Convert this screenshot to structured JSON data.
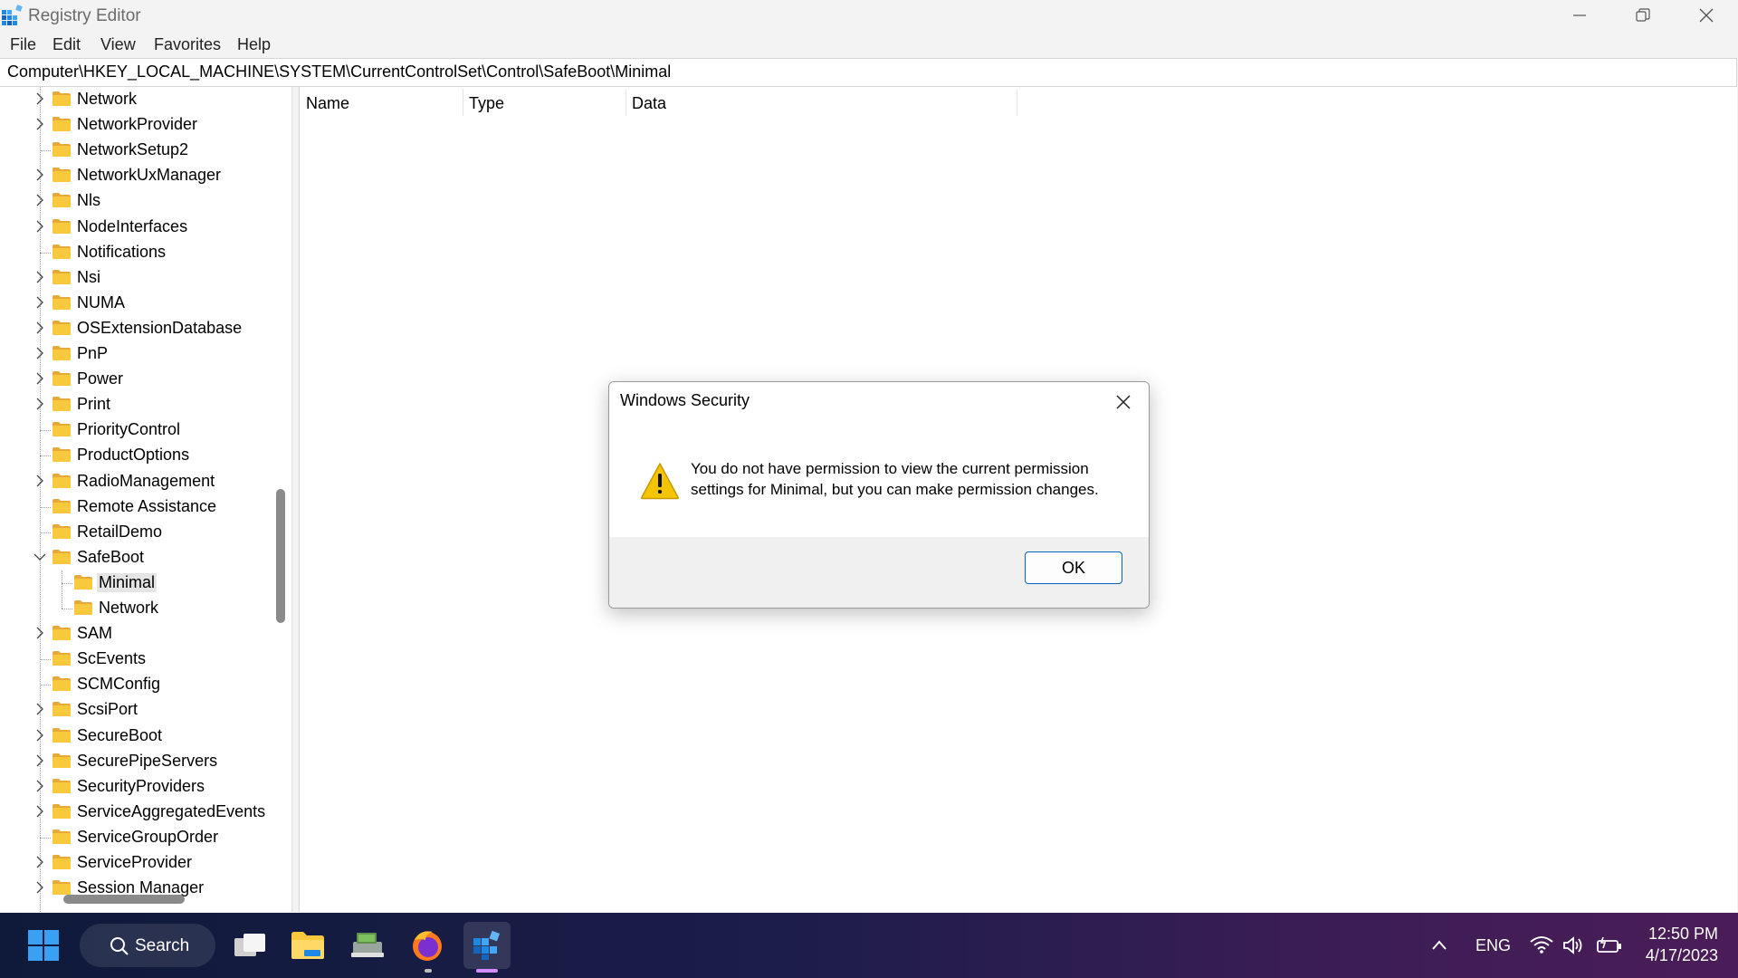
{
  "window": {
    "title": "Registry Editor"
  },
  "menu": [
    "File",
    "Edit",
    "View",
    "Favorites",
    "Help"
  ],
  "address": "Computer\\HKEY_LOCAL_MACHINE\\SYSTEM\\CurrentControlSet\\Control\\SafeBoot\\Minimal",
  "tree": [
    {
      "label": "Network",
      "expander": "collapsed",
      "depth": 0
    },
    {
      "label": "NetworkProvider",
      "expander": "collapsed",
      "depth": 0
    },
    {
      "label": "NetworkSetup2",
      "expander": "none",
      "depth": 0
    },
    {
      "label": "NetworkUxManager",
      "expander": "collapsed",
      "depth": 0
    },
    {
      "label": "Nls",
      "expander": "collapsed",
      "depth": 0
    },
    {
      "label": "NodeInterfaces",
      "expander": "collapsed",
      "depth": 0
    },
    {
      "label": "Notifications",
      "expander": "none",
      "depth": 0
    },
    {
      "label": "Nsi",
      "expander": "collapsed",
      "depth": 0
    },
    {
      "label": "NUMA",
      "expander": "collapsed",
      "depth": 0
    },
    {
      "label": "OSExtensionDatabase",
      "expander": "collapsed",
      "depth": 0
    },
    {
      "label": "PnP",
      "expander": "collapsed",
      "depth": 0
    },
    {
      "label": "Power",
      "expander": "collapsed",
      "depth": 0
    },
    {
      "label": "Print",
      "expander": "collapsed",
      "depth": 0
    },
    {
      "label": "PriorityControl",
      "expander": "none",
      "depth": 0
    },
    {
      "label": "ProductOptions",
      "expander": "none",
      "depth": 0
    },
    {
      "label": "RadioManagement",
      "expander": "collapsed",
      "depth": 0
    },
    {
      "label": "Remote Assistance",
      "expander": "none",
      "depth": 0
    },
    {
      "label": "RetailDemo",
      "expander": "none",
      "depth": 0
    },
    {
      "label": "SafeBoot",
      "expander": "expanded",
      "depth": 0
    },
    {
      "label": "Minimal",
      "expander": "none",
      "depth": 1,
      "selected": true
    },
    {
      "label": "Network",
      "expander": "none",
      "depth": 1
    },
    {
      "label": "SAM",
      "expander": "collapsed",
      "depth": 0
    },
    {
      "label": "ScEvents",
      "expander": "none",
      "depth": 0
    },
    {
      "label": "SCMConfig",
      "expander": "none",
      "depth": 0
    },
    {
      "label": "ScsiPort",
      "expander": "collapsed",
      "depth": 0
    },
    {
      "label": "SecureBoot",
      "expander": "collapsed",
      "depth": 0
    },
    {
      "label": "SecurePipeServers",
      "expander": "collapsed",
      "depth": 0
    },
    {
      "label": "SecurityProviders",
      "expander": "collapsed",
      "depth": 0
    },
    {
      "label": "ServiceAggregatedEvents",
      "expander": "collapsed",
      "depth": 0
    },
    {
      "label": "ServiceGroupOrder",
      "expander": "none",
      "depth": 0
    },
    {
      "label": "ServiceProvider",
      "expander": "collapsed",
      "depth": 0
    },
    {
      "label": "Session Manager",
      "expander": "collapsed",
      "depth": 0
    }
  ],
  "list": {
    "columns": [
      "Name",
      "Type",
      "Data"
    ]
  },
  "dialog": {
    "title": "Windows Security",
    "message_line1": "You do not have permission to view the current permission",
    "message_line2": "settings for Minimal, but you can make permission changes.",
    "ok_label": "OK",
    "icon": "warning-icon"
  },
  "taskbar": {
    "search_label": "Search",
    "language": "ENG",
    "time": "12:50 PM",
    "date": "4/17/2023"
  },
  "colors": {
    "accent": "#0067c0",
    "folder": "#f8c93d",
    "warning": "#f5c400"
  }
}
